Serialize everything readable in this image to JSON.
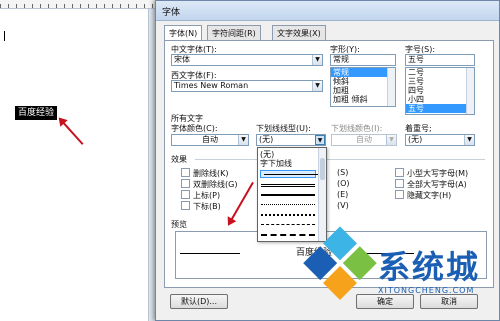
{
  "document": {
    "selected_text": "百度经验"
  },
  "dialog": {
    "title": "字体",
    "tabs": [
      {
        "label": "字体(N)",
        "active": true
      },
      {
        "label": "字符间距(R)",
        "active": false
      },
      {
        "label": "文字效果(X)",
        "active": false
      }
    ],
    "chinese_font": {
      "label": "中文字体(T):",
      "value": "宋体"
    },
    "western_font": {
      "label": "西文字体(F):",
      "value": "Times New Roman"
    },
    "style": {
      "label": "字形(Y):",
      "value": "常规",
      "options": [
        "常规",
        "倾斜",
        "加粗",
        "加粗 倾斜"
      ],
      "selected": "常规"
    },
    "size": {
      "label": "字号(S):",
      "value": "五号",
      "options": [
        "二号",
        "三号",
        "四号",
        "小四",
        "五号"
      ],
      "selected": "五号"
    },
    "all_text_label": "所有文字",
    "font_color": {
      "label": "字体颜色(C):",
      "value": "自动"
    },
    "underline_type": {
      "label": "下划线线型(U):",
      "value": "(无)"
    },
    "underline_color": {
      "label": "下划线颜色(I):",
      "value": "自动"
    },
    "emphasis": {
      "label": "着重号;",
      "value": "(无)"
    },
    "effects_label": "效果",
    "effects_left": [
      "删除线(K)",
      "双删除线(G)",
      "上标(P)",
      "下标(B)"
    ],
    "effects_right": [
      "小型大写字母(M)",
      "全部大写字母(A)",
      "隐藏文字(H)"
    ],
    "effects_mid_suffix": [
      "(S)",
      "(O)",
      "(E)",
      "(V)"
    ],
    "preview_label": "预览",
    "preview_text": "百度经验",
    "buttons": {
      "default": "默认(D)...",
      "ok": "确定",
      "cancel": "取消"
    },
    "underline_popup": {
      "options": [
        "(无)",
        "字下加线"
      ],
      "line_styles": [
        "solid",
        "double",
        "thick",
        "dotted",
        "dashed",
        "dash-dot",
        "dash-dot-dot"
      ]
    }
  },
  "watermark": {
    "text": "系统城",
    "url": "XITONGCHENG.COM",
    "colors": {
      "blue": "#1a5fb4",
      "green": "#7ac143",
      "orange": "#f7a21b",
      "lightblue": "#3cb4e6"
    }
  },
  "colors": {
    "selection": "#3399ff",
    "arrow": "#c8101e"
  }
}
